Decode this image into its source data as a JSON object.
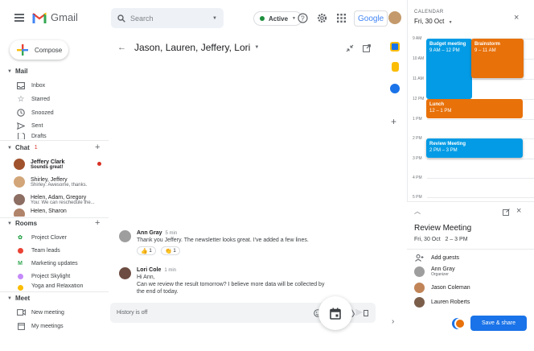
{
  "app": {
    "name": "Gmail"
  },
  "search": {
    "placeholder": "Search"
  },
  "status": {
    "label": "Active"
  },
  "brand": {
    "google": "Google"
  },
  "compose": {
    "label": "Compose"
  },
  "mail": {
    "header": "Mail",
    "items": [
      {
        "label": "Inbox",
        "icon": "inbox-icon"
      },
      {
        "label": "Starred",
        "icon": "star-icon"
      },
      {
        "label": "Snoozed",
        "icon": "clock-icon"
      },
      {
        "label": "Sent",
        "icon": "send-icon"
      },
      {
        "label": "Drafts",
        "icon": "draft-icon"
      }
    ]
  },
  "chat": {
    "header": "Chat",
    "unread": "1",
    "items": [
      {
        "name": "Jeffery Clark",
        "snippet": "Sounds great!"
      },
      {
        "name": "Shirley, Jeffery",
        "snippet": "Shirley: Awesome, thanks."
      },
      {
        "name": "Helen, Adam, Gregory",
        "snippet": "You: We can reschedule the..."
      },
      {
        "name": "Helen, Sharon",
        "snippet": ""
      }
    ]
  },
  "rooms": {
    "header": "Rooms",
    "items": [
      {
        "label": "Project Clover",
        "color": "#34a853"
      },
      {
        "label": "Team leads",
        "color": "#ea4335"
      },
      {
        "label": "Marketing updates",
        "color": "#34a853"
      },
      {
        "label": "Project Skylight",
        "color": "#a142f4"
      },
      {
        "label": "Yoga and Relaxation",
        "color": "#fbbc04"
      }
    ]
  },
  "meet": {
    "header": "Meet",
    "items": [
      {
        "label": "New meeting"
      },
      {
        "label": "My meetings"
      }
    ]
  },
  "conversation": {
    "title": "Jason, Lauren, Jeffery, Lori",
    "messages": [
      {
        "author": "Ann Gray",
        "time": "5 min",
        "lines": [
          "Thank you Jeffery. The newsletter looks great. I've added a few lines."
        ],
        "reactions": [
          {
            "emoji": "👍",
            "count": "1"
          },
          {
            "emoji": "👏",
            "count": "1"
          }
        ]
      },
      {
        "author": "Lori Cole",
        "time": "1 min",
        "lines": [
          "Hi Ann,",
          "Can we review the result tomorrow? I believe more data will be collected by",
          "the end of today."
        ]
      }
    ],
    "input_placeholder": "History is off"
  },
  "calendar": {
    "label": "CALENDAR",
    "date": "Fri, 30 Oct",
    "hours": [
      "9 AM",
      "10 AM",
      "11 AM",
      "12 PM",
      "1 PM",
      "2 PM",
      "3 PM",
      "4 PM",
      "5 PM"
    ],
    "events": [
      {
        "title": "Budget meeting",
        "time": "9 AM – 12 PM",
        "color": "#039be5"
      },
      {
        "title": "Brainstorm",
        "time": "9 – 11 AM",
        "color": "#e8710a"
      },
      {
        "title": "Lunch",
        "time": "12 – 1 PM",
        "color": "#e8710a"
      },
      {
        "title": "Review Meeting",
        "time": "2 PM – 3 PM",
        "color": "#039be5"
      }
    ]
  },
  "event_detail": {
    "title": "Review Meeting",
    "when": "Fri, 30 Oct   2 – 3 PM",
    "add_guests": "Add guests",
    "guests": [
      {
        "name": "Ann Gray",
        "role": "Organizer"
      },
      {
        "name": "Jason Coleman",
        "role": ""
      },
      {
        "name": "Lauren Roberts",
        "role": ""
      }
    ],
    "save_label": "Save & share"
  }
}
